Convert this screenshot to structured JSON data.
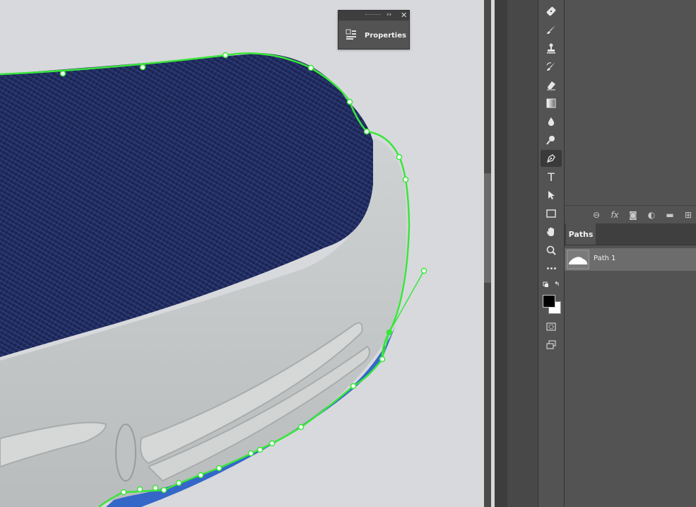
{
  "properties_panel": {
    "title": "Properties",
    "collapse_icon": "double-chevron-right-icon",
    "close_icon": "close-icon",
    "panel_icon": "properties-icon"
  },
  "paths_panel": {
    "tab_label": "Paths",
    "items": [
      {
        "name": "Path 1",
        "selected": true
      }
    ],
    "footer_icons": [
      "link-icon",
      "fx-icon",
      "mask-icon",
      "adjustment-icon",
      "folder-icon",
      "new-layer-icon"
    ]
  },
  "toolbar": {
    "tools": [
      {
        "name": "healing-brush-icon",
        "active": false
      },
      {
        "name": "brush-icon",
        "active": false
      },
      {
        "name": "clone-stamp-icon",
        "active": false
      },
      {
        "name": "history-brush-icon",
        "active": false
      },
      {
        "name": "eraser-icon",
        "active": false
      },
      {
        "name": "gradient-icon",
        "active": false
      },
      {
        "name": "blur-icon",
        "active": false
      },
      {
        "name": "dodge-icon",
        "active": false
      },
      {
        "name": "pen-icon",
        "active": true
      },
      {
        "name": "type-icon",
        "active": false
      },
      {
        "name": "path-selection-icon",
        "active": false
      },
      {
        "name": "rectangle-icon",
        "active": false
      },
      {
        "name": "hand-icon",
        "active": false
      },
      {
        "name": "zoom-icon",
        "active": false
      },
      {
        "name": "more-tools-icon",
        "active": false
      }
    ],
    "type_glyph": "T",
    "more_glyph": "•••",
    "foreground_color": "#000000",
    "background_color": "#ffffff"
  },
  "colors": {
    "path_stroke": "#39e63b",
    "canvas_bg": "#d8d9dd",
    "ui_bg": "#535353"
  }
}
